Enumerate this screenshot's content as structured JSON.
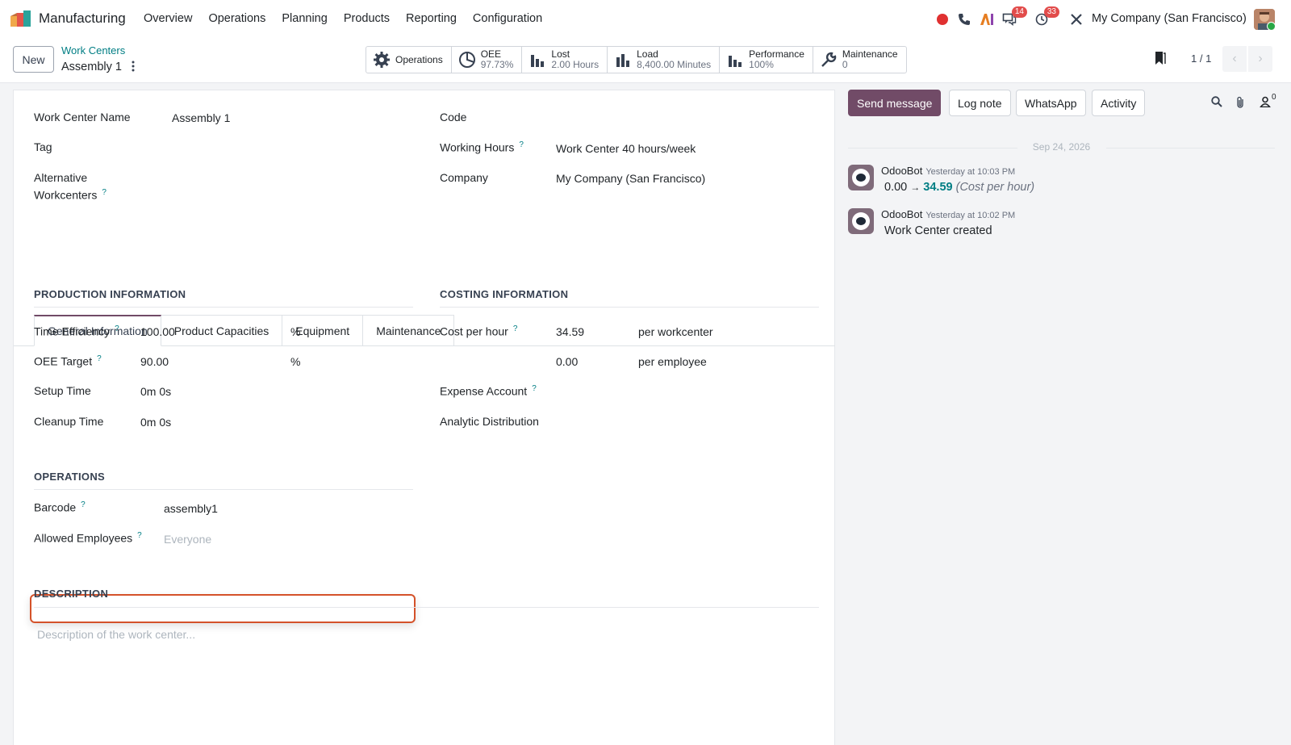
{
  "app": {
    "name": "Manufacturing",
    "menu": [
      "Overview",
      "Operations",
      "Planning",
      "Products",
      "Reporting",
      "Configuration"
    ],
    "company": "My Company (San Francisco)",
    "badges": {
      "messages": "14",
      "activities": "33"
    }
  },
  "control": {
    "new_label": "New",
    "breadcrumb_parent": "Work Centers",
    "breadcrumb_current": "Assembly 1",
    "pager": "1 / 1",
    "smart_buttons": [
      {
        "label": "Operations",
        "value": ""
      },
      {
        "label": "OEE",
        "value": "97.73%"
      },
      {
        "label": "Lost",
        "value": "2.00 Hours"
      },
      {
        "label": "Load",
        "value": "8,400.00 Minutes"
      },
      {
        "label": "Performance",
        "value": "100%"
      },
      {
        "label": "Maintenance",
        "value": "0"
      }
    ]
  },
  "form": {
    "work_center_name_label": "Work Center Name",
    "work_center_name": "Assembly 1",
    "tag_label": "Tag",
    "alt_wc_label_1": "Alternative",
    "alt_wc_label_2": "Workcenters",
    "code_label": "Code",
    "working_hours_label": "Working Hours",
    "working_hours": "Work Center 40 hours/week",
    "company_label": "Company",
    "company": "My Company (San Francisco)",
    "tabs": [
      "General Information",
      "Product Capacities",
      "Equipment",
      "Maintenance"
    ],
    "production": {
      "title": "PRODUCTION INFORMATION",
      "time_efficiency_label": "Time Efficiency",
      "time_efficiency": "100.00",
      "oee_target_label": "OEE Target",
      "oee_target": "90.00",
      "percent": "%",
      "setup_time_label": "Setup Time",
      "setup_time": "0m 0s",
      "cleanup_time_label": "Cleanup Time",
      "cleanup_time": "0m 0s"
    },
    "costing": {
      "title": "COSTING INFORMATION",
      "cost_per_hour_label": "Cost per hour",
      "cost_per_hour": "34.59",
      "per_workcenter": "per workcenter",
      "employee_cost": "0.00",
      "per_employee": "per employee",
      "expense_account_label": "Expense Account",
      "analytic_label": "Analytic Distribution"
    },
    "operations": {
      "title": "OPERATIONS",
      "barcode_label": "Barcode",
      "barcode": "assembly1",
      "allowed_employees_label": "Allowed Employees",
      "allowed_employees_placeholder": "Everyone"
    },
    "description": {
      "title": "DESCRIPTION",
      "placeholder": "Description of the work center..."
    }
  },
  "chatter": {
    "send_message": "Send message",
    "log_note": "Log note",
    "whatsapp": "WhatsApp",
    "activity": "Activity",
    "followers_count": "0",
    "date": "Sep 24, 2026",
    "messages": [
      {
        "author": "OdooBot",
        "time": "Yesterday at 10:03 PM",
        "old": "0.00",
        "arrow": "→",
        "new": "34.59",
        "field": "(Cost per hour)"
      },
      {
        "author": "OdooBot",
        "time": "Yesterday at 10:02 PM",
        "body": "Work Center created"
      }
    ]
  },
  "colors": {
    "brand": "#714b67",
    "link": "#017e84",
    "highlight": "#d4522a"
  }
}
